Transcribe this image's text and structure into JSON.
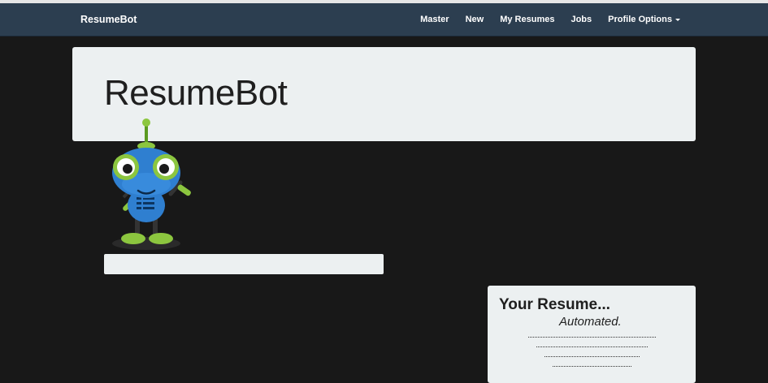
{
  "navbar": {
    "brand": "ResumeBot",
    "links": [
      {
        "label": "Master"
      },
      {
        "label": "New"
      },
      {
        "label": "My Resumes"
      },
      {
        "label": "Jobs"
      },
      {
        "label": "Profile Options"
      }
    ]
  },
  "jumbotron": {
    "title": "ResumeBot"
  },
  "mascot": {
    "icon": "robot-mascot-icon"
  },
  "resume_card": {
    "title": "Your Resume...",
    "subtitle": "Automated."
  },
  "colors": {
    "navbar": "#2c3e50",
    "background": "#181818",
    "panel": "#ecf0f1",
    "robot_body": "#2f7fd0",
    "robot_accent": "#8cc63f"
  }
}
